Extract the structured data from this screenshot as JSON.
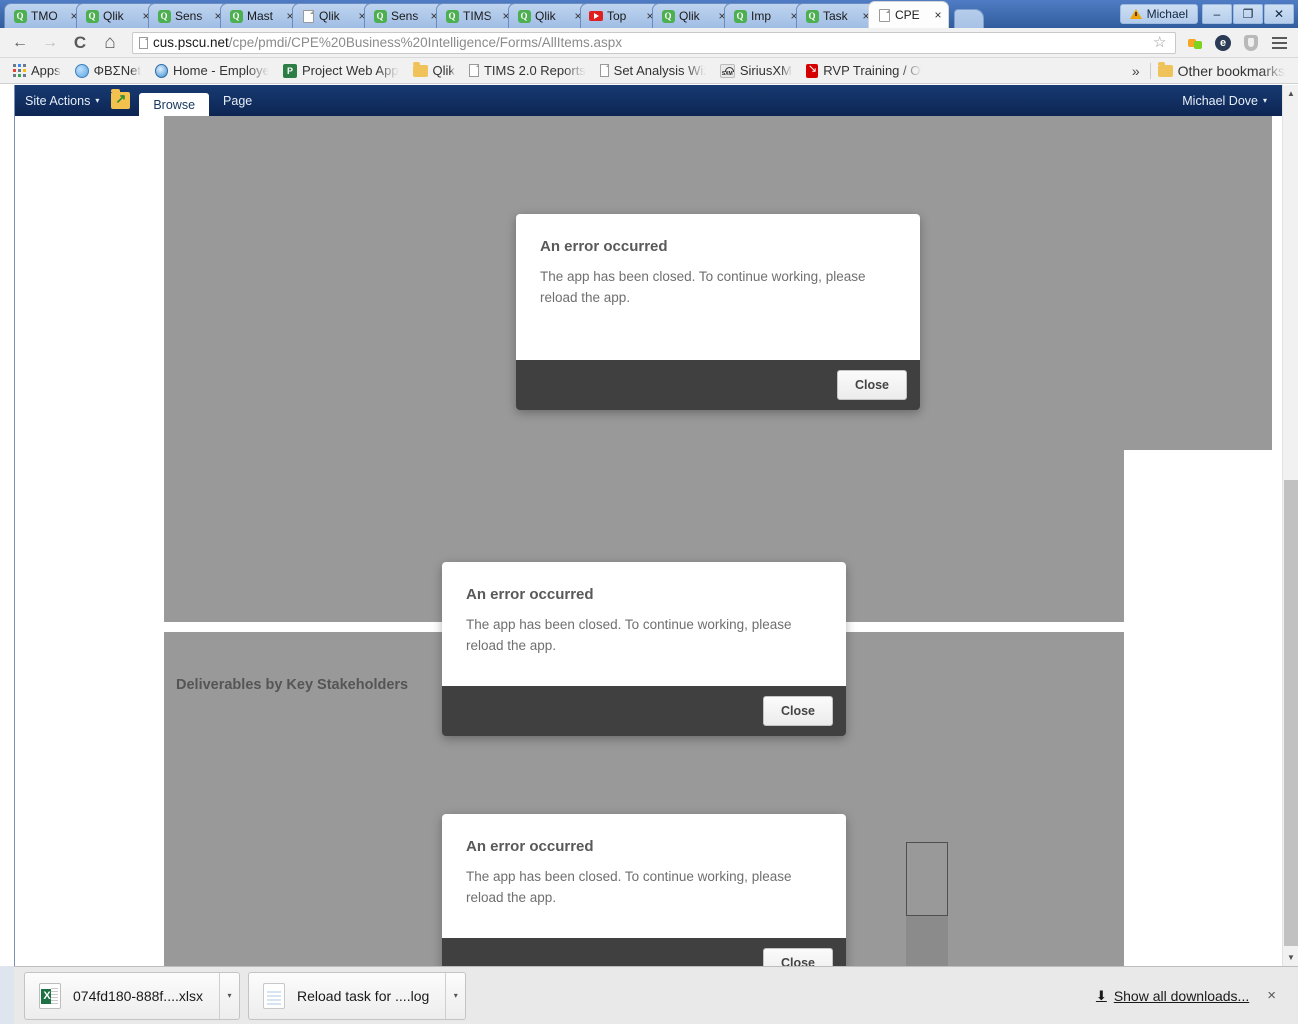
{
  "browser": {
    "tabs": [
      {
        "label": "TMO",
        "icon": "qlik-icon",
        "active": false
      },
      {
        "label": "Qlik",
        "icon": "qlik-icon",
        "active": false
      },
      {
        "label": "Sens",
        "icon": "qlik-icon",
        "active": false
      },
      {
        "label": "Mast",
        "icon": "qlik-icon",
        "active": false
      },
      {
        "label": "Qlik",
        "icon": "document-icon",
        "active": false
      },
      {
        "label": "Sens",
        "icon": "qlik-icon",
        "active": false
      },
      {
        "label": "TIMS",
        "icon": "qlik-icon",
        "active": false
      },
      {
        "label": "Qlik",
        "icon": "qlik-icon",
        "active": false
      },
      {
        "label": "Top",
        "icon": "youtube-icon",
        "active": false
      },
      {
        "label": "Qlik",
        "icon": "qlik-icon",
        "active": false
      },
      {
        "label": "Imp",
        "icon": "qlik-icon",
        "active": false
      },
      {
        "label": "Task",
        "icon": "qlik-icon",
        "active": false
      },
      {
        "label": "CPE",
        "icon": "document-icon",
        "active": true
      }
    ],
    "tab_close_glyph": "×",
    "new_tab_name": "new-tab-button",
    "window": {
      "profile_label": "Michael",
      "minimize": "–",
      "restore": "❐",
      "close": "✕"
    },
    "nav": {
      "back": "←",
      "forward": "→",
      "reload": "C",
      "home": "⌂"
    },
    "omnibox": {
      "url_host": "cus.pscu.net",
      "url_path": "/cpe/pmdi/CPE%20Business%20Intelligence/Forms/AllItems.aspx",
      "star": "☆"
    },
    "toolbar_icons": [
      "extension-icon",
      "profile-circle-icon",
      "shield-icon",
      "chrome-menu-icon"
    ],
    "bookmarks": [
      {
        "label": "Apps",
        "icon": "apps-grid-icon"
      },
      {
        "label": "ΦΒΣNet",
        "icon": "globe-icon"
      },
      {
        "label": "Home - Employee",
        "icon": "ie-globe-icon"
      },
      {
        "label": "Project Web App",
        "icon": "project-icon"
      },
      {
        "label": "Qlik",
        "icon": "folder-icon"
      },
      {
        "label": "TIMS 2.0 Reports",
        "icon": "document-icon"
      },
      {
        "label": "Set Analysis Wizar",
        "icon": "document-icon"
      },
      {
        "label": "SiriusXM",
        "icon": "siriusxm-icon"
      },
      {
        "label": "RVP Training / Ove",
        "icon": "rvp-icon"
      }
    ],
    "bookmarks_overflow": "»",
    "other_bookmarks": {
      "label": "Other bookmarks",
      "icon": "folder-icon"
    }
  },
  "sharepoint": {
    "site_actions": "Site Actions",
    "site_actions_caret": "▾",
    "nav_icon": "navigate-up-icon",
    "tabs": [
      {
        "label": "Browse",
        "active": true
      },
      {
        "label": "Page",
        "active": false
      }
    ],
    "user": "Michael Dove",
    "user_caret": "▾"
  },
  "content": {
    "panel3_heading": "Deliverables by Key Stakeholders"
  },
  "dialogs": [
    {
      "title": "An error occurred",
      "message": "The app has been closed. To continue working, please reload the app.",
      "button": "Close"
    },
    {
      "title": "An error occurred",
      "message": "The app has been closed. To continue working, please reload the app.",
      "button": "Close"
    },
    {
      "title": "An error occurred",
      "message": "The app has been closed. To continue working, please reload the app.",
      "button": "Close"
    }
  ],
  "scrollbar": {
    "up_arrow": "▲",
    "down_arrow": "▼"
  },
  "downloads": [
    {
      "name": "074fd180-888f....xlsx",
      "icon": "excel-file-icon",
      "menu": "▾"
    },
    {
      "name": "Reload task for ....log",
      "icon": "log-file-icon",
      "menu": "▾"
    }
  ],
  "shelf": {
    "show_all": "Show all downloads...",
    "download_arrow": "⬇",
    "close": "×"
  },
  "colors": {
    "chrome_tab_active": "#fdfdfd",
    "sharepoint_navy": "#173a72",
    "panel_grey": "#999999",
    "dialog_footer": "#404040"
  }
}
